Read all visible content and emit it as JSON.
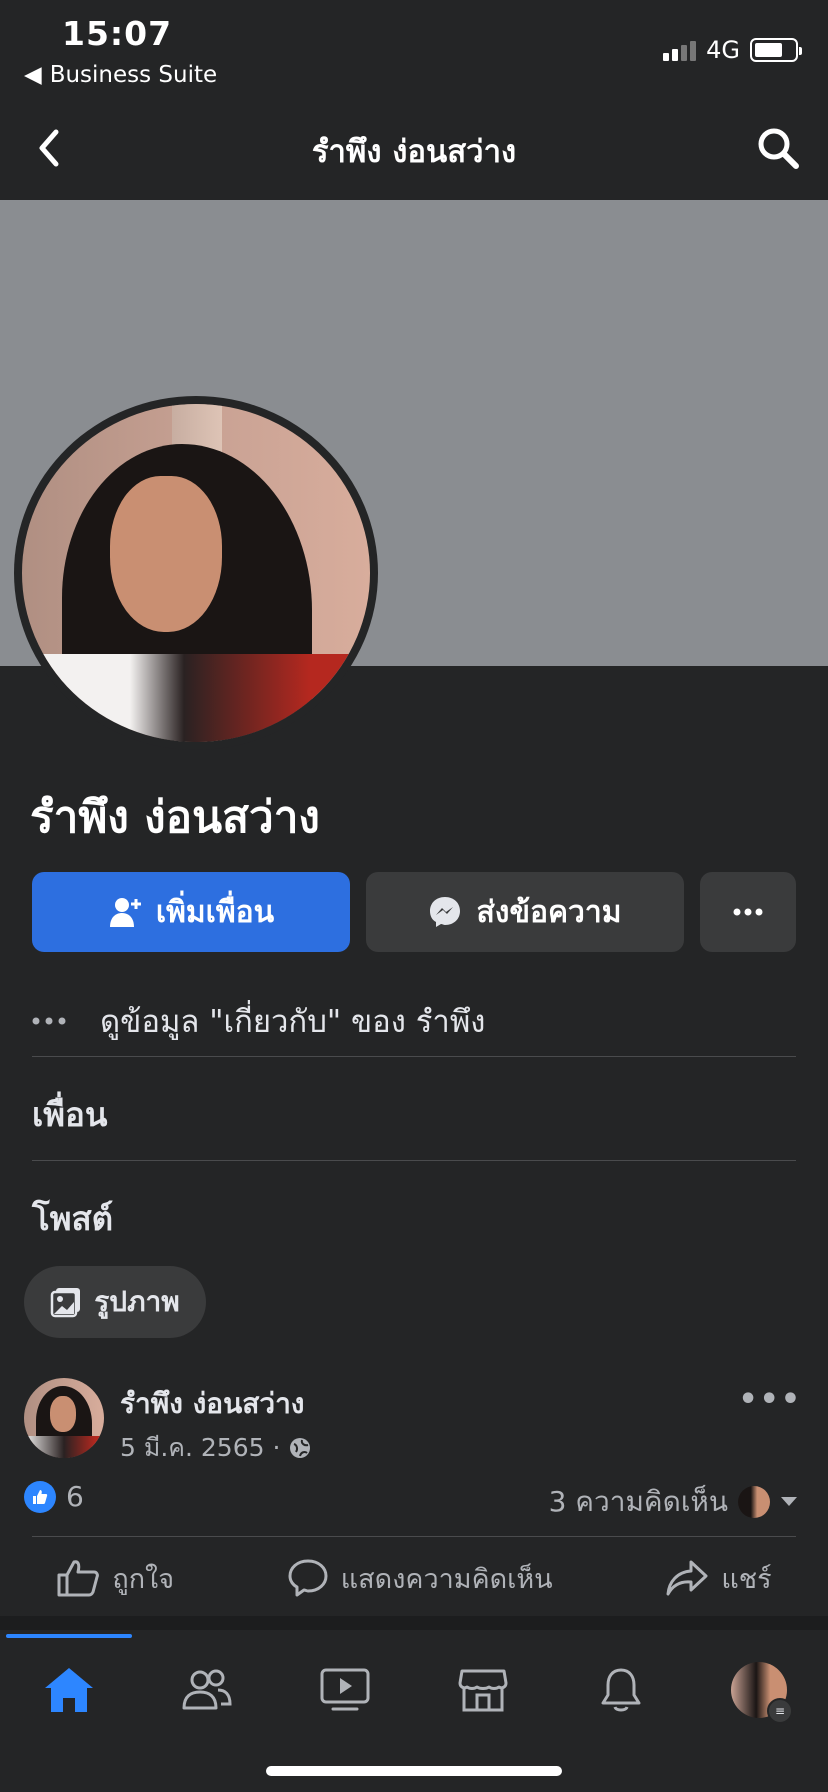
{
  "status": {
    "time": "15:07",
    "back_app": "Business Suite",
    "network": "4G"
  },
  "nav": {
    "title": "รำพึง ง่อนสว่าง"
  },
  "profile": {
    "name": "รำพึง ง่อนสว่าง"
  },
  "actions": {
    "add_friend": "เพิ่มเพื่อน",
    "message": "ส่งข้อความ"
  },
  "about": {
    "label": "ดูข้อมูล \"เกี่ยวกับ\" ของ รำพึง"
  },
  "sections": {
    "friends": "เพื่อน",
    "posts": "โพสต์"
  },
  "chip": {
    "photos": "รูปภาพ"
  },
  "post": {
    "author": "รำพึง ง่อนสว่าง",
    "date": "5 มี.ค. 2565 ·",
    "likes": "6",
    "comments": "3 ความคิดเห็น",
    "like_label": "ถูกใจ",
    "comment_label": "แสดงความคิดเห็น",
    "share_label": "แชร์"
  },
  "tabs": [
    "home-icon",
    "friends-icon",
    "watch-icon",
    "marketplace-icon",
    "notifications-icon",
    "profile-menu"
  ],
  "colors": {
    "accent": "#2d6fe0",
    "background": "#242526",
    "cover": "#8a8d91"
  }
}
